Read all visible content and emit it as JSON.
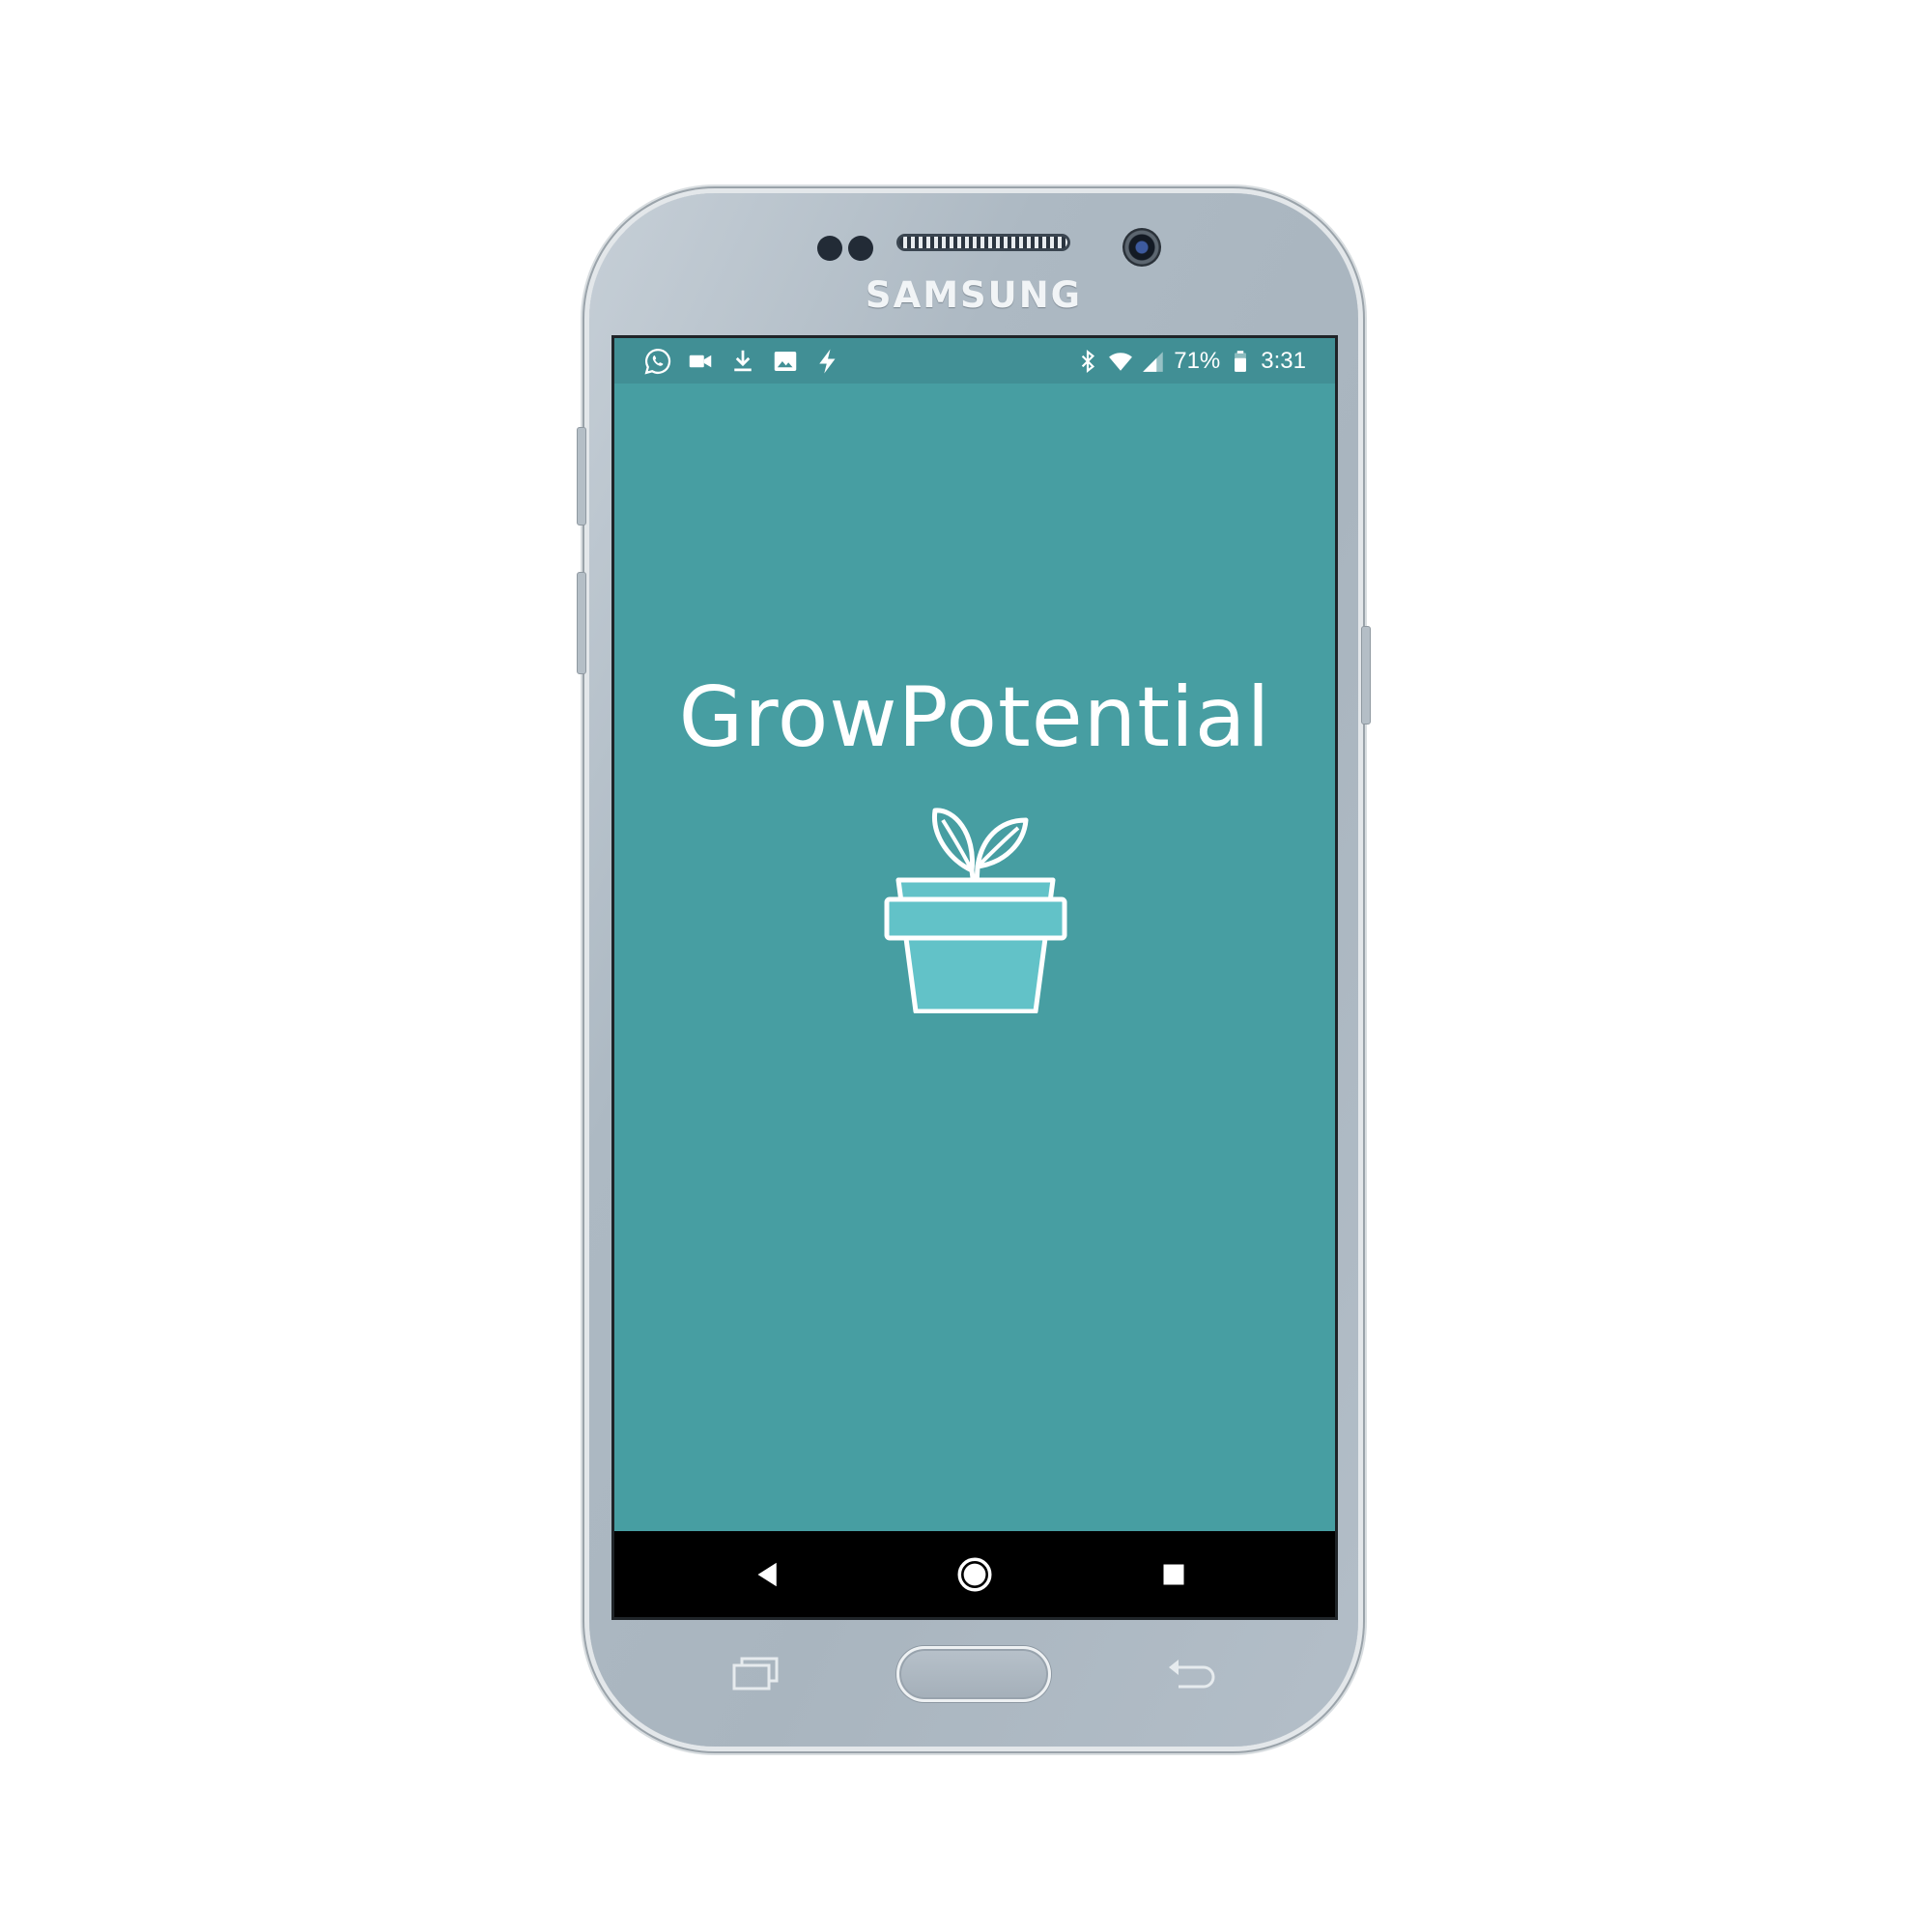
{
  "device": {
    "brand": "SAMSUNG"
  },
  "status_bar": {
    "notification_icons": [
      "whatsapp-icon",
      "video-camera-icon",
      "download-icon",
      "image-icon",
      "flash-icon"
    ],
    "system_icons": [
      "bluetooth-icon",
      "wifi-icon",
      "cellular-signal-icon",
      "battery-icon"
    ],
    "battery_text": "71%",
    "time": "3:31"
  },
  "app": {
    "title": "GrowPotential",
    "logo_icon": "plant-pot-icon",
    "background_color": "#479ea2",
    "pot_fill_color": "#62c2c8",
    "status_bar_color": "#418f95"
  },
  "nav_bar": {
    "buttons": [
      "back-icon",
      "home-icon",
      "recents-icon"
    ]
  },
  "hardware_keys": [
    "recents-key",
    "home-key",
    "back-key"
  ]
}
